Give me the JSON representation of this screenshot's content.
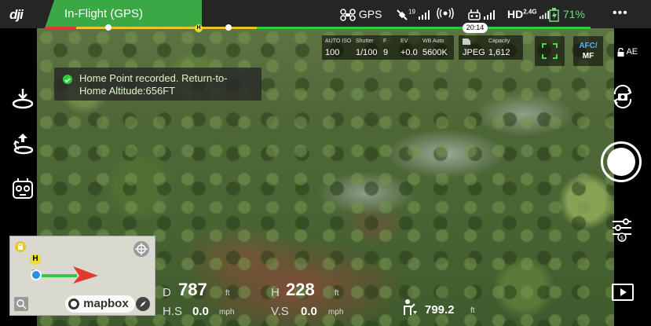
{
  "topbar": {
    "logo": "dji",
    "flight_status": "In-Flight (GPS)",
    "gps_label": "GPS",
    "gps_satellites": "19",
    "video_quality": "HD",
    "video_band": "2.4G",
    "battery_percent": "71%",
    "more_label": "•••",
    "flight_time": "20:14"
  },
  "camera": {
    "iso_label": "AUTO ISO",
    "iso_value": "100",
    "shutter_label": "Shutter",
    "shutter_value": "1/100",
    "f_label": "F",
    "f_value": "9",
    "ev_label": "EV",
    "ev_value": "+0.0",
    "wb_label": "WB Auto",
    "wb_value": "5600K",
    "format_value": "JPEG",
    "capacity_label": "Capacity",
    "capacity_value": "1,612",
    "focus_mode_line1": "AFC/",
    "focus_mode_line2": "MF",
    "ae_label": "AE"
  },
  "toast": {
    "message": "Home Point recorded. Return-to-Home Altitude:656FT"
  },
  "map": {
    "home_marker": "H",
    "attribution": "mapbox"
  },
  "telemetry": {
    "distance_label": "D",
    "distance_value": "787",
    "distance_unit": "ft",
    "height_label": "H",
    "height_value": "228",
    "height_unit": "ft",
    "hspeed_label": "H.S",
    "hspeed_value": "0.0",
    "hspeed_unit": "mph",
    "vspeed_label": "V.S",
    "vspeed_value": "0.0",
    "vspeed_unit": "mph",
    "rc_distance_value": "799.2",
    "rc_distance_unit": "ft"
  },
  "colors": {
    "status_green": "#3aa845",
    "battery_green": "#2ecc40",
    "battery_yellow": "#e8c52a",
    "battery_red": "#e03a2a"
  },
  "battery_level": 0.71
}
